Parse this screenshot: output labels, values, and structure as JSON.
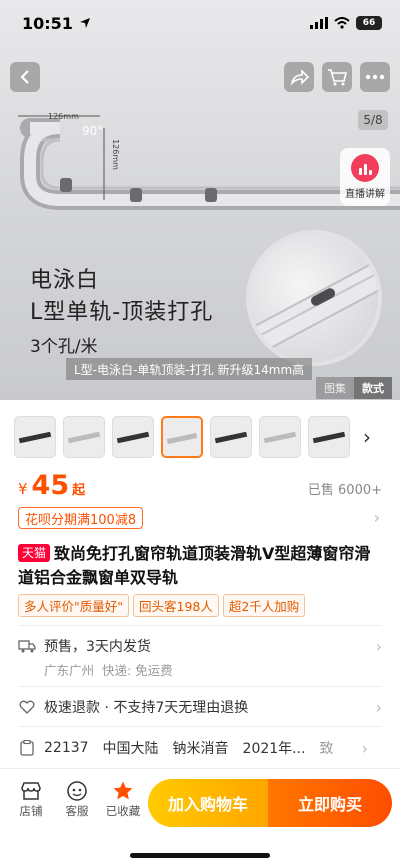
{
  "status": {
    "time": "10:51",
    "battery": "66"
  },
  "gallery": {
    "counter": "5/8",
    "live_label": "直播讲解",
    "hero_line1": "电泳白",
    "hero_line2": "L型单轨-顶装打孔",
    "hero_line3": "3个孔/米",
    "dim_horizontal": "126mm",
    "dim_vertical": "126mm",
    "angle": "90°",
    "caption": "L型-电泳白-单轨顶装-打孔 新升级14mm高",
    "tabs": [
      "图集",
      "款式"
    ]
  },
  "price": {
    "currency": "¥",
    "amount": "45",
    "suffix": "起",
    "sold": "已售 6000+"
  },
  "promo": "花呗分期满100减8",
  "product": {
    "badge": "天猫",
    "title": "致尚免打孔窗帘轨道顶装滑轨V型超薄窗帘滑道铝合金飘窗单双导轨",
    "tags": [
      "多人评价\"质量好\"",
      "回头客198人",
      "超2千人加购"
    ]
  },
  "shipping": {
    "text": "预售，3天内发货",
    "from": "广东广州",
    "fee": "快递: 免运费"
  },
  "service": {
    "text": "极速退款 · 不支持7天无理由退换"
  },
  "specs": [
    "22137",
    "中国大陆",
    "钠米消音",
    "2021年...",
    "致"
  ],
  "bottom": {
    "shop": "店铺",
    "service": "客服",
    "favorite": "已收藏",
    "add_cart": "加入购物车",
    "buy_now": "立即购买"
  },
  "colors": {
    "accent": "#ff5000",
    "tmall": "#ff0036",
    "cart_btn": "#ffb300",
    "buy_btn": "#ff5a00"
  }
}
